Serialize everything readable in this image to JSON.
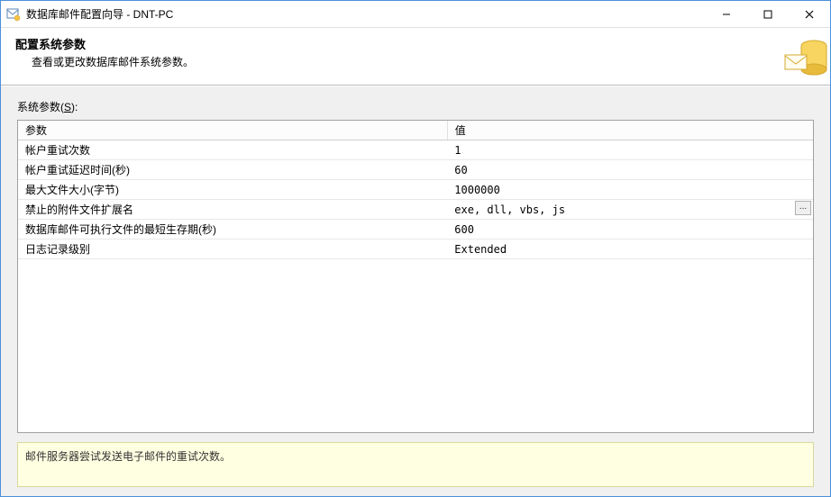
{
  "window": {
    "title": "数据库邮件配置向导 - DNT-PC"
  },
  "header": {
    "title": "配置系统参数",
    "subtitle": "查看或更改数据库邮件系统参数。"
  },
  "section": {
    "label_prefix": "系统参数(",
    "label_key": "S",
    "label_suffix": "):"
  },
  "columns": {
    "param": "参数",
    "value": "值"
  },
  "rows": [
    {
      "param": "帐户重试次数",
      "value": "1",
      "has_button": false
    },
    {
      "param": "帐户重试延迟时间(秒)",
      "value": "60",
      "has_button": false
    },
    {
      "param": "最大文件大小(字节)",
      "value": "1000000",
      "has_button": false
    },
    {
      "param": "禁止的附件文件扩展名",
      "value": "exe, dll, vbs, js",
      "has_button": true
    },
    {
      "param": "数据库邮件可执行文件的最短生存期(秒)",
      "value": "600",
      "has_button": false
    },
    {
      "param": "日志记录级别",
      "value": "Extended",
      "has_button": false
    }
  ],
  "hint": "邮件服务器尝试发送电子邮件的重试次数。",
  "ellipsis": "..."
}
